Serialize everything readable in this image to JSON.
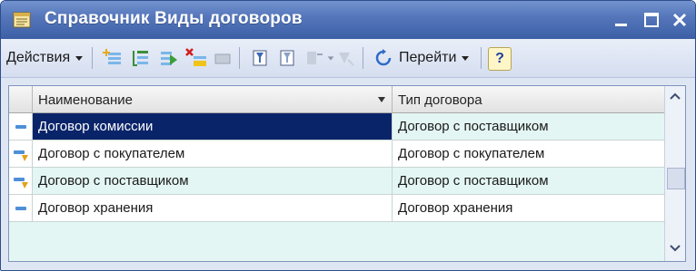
{
  "window": {
    "title": "Справочник Виды договоров",
    "controls": [
      "minimize-icon",
      "maximize-icon",
      "close-icon"
    ]
  },
  "toolbar": {
    "actions_label": "Действия",
    "goto_label": "Перейти",
    "help_label": "?",
    "icons": [
      "add-icon",
      "add-group-icon",
      "copy-icon",
      "delete-mark-icon",
      "edit-icon",
      "filter-icon",
      "filter-off-icon",
      "sort-icon",
      "hierarchy-icon",
      "refresh-icon"
    ]
  },
  "table": {
    "columns": [
      "Наименование",
      "Тип договора"
    ],
    "rows": [
      {
        "name": "Договор комиссии",
        "type": "Договор с поставщиком",
        "marker": "dash",
        "selected": true
      },
      {
        "name": "Договор с покупателем",
        "type": "Договор с покупателем",
        "marker": "edit",
        "selected": false
      },
      {
        "name": "Договор с поставщиком",
        "type": "Договор с поставщиком",
        "marker": "edit",
        "selected": false
      },
      {
        "name": "Договор хранения",
        "type": "Договор хранения",
        "marker": "dash",
        "selected": false
      }
    ]
  },
  "colors": {
    "title_bar": "#4a6db5",
    "row_highlight": "#e3f6f3",
    "selection": "#0a246a"
  }
}
